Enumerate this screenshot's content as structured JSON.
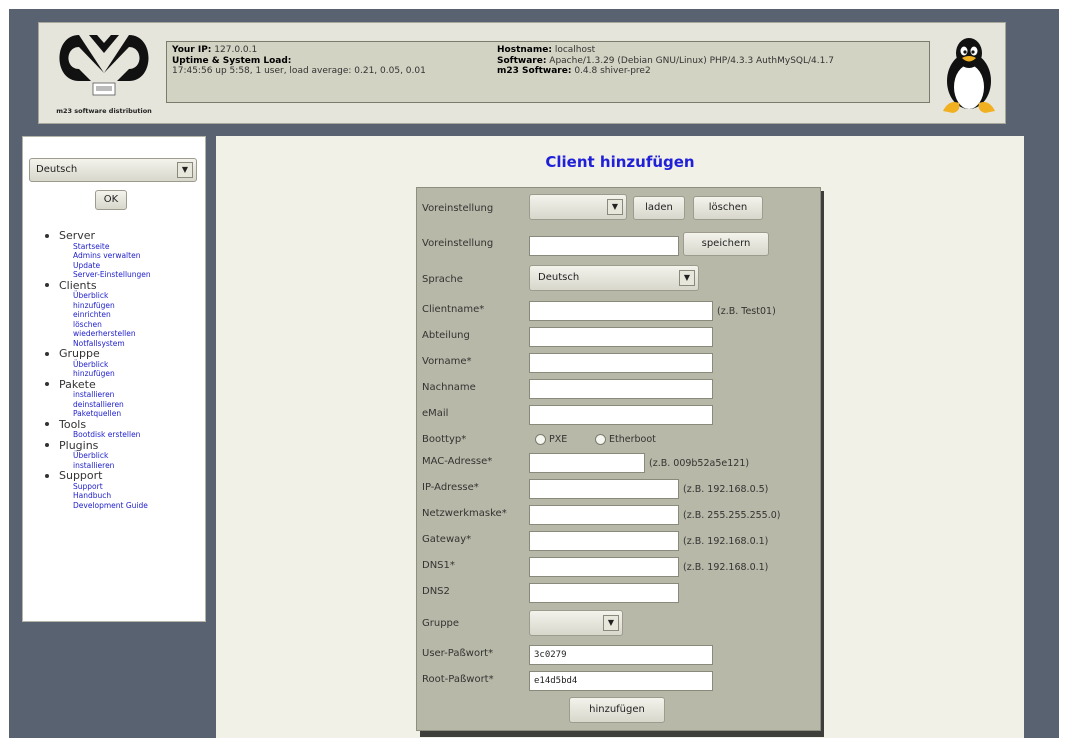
{
  "header": {
    "logo_caption": "m23 software distribution",
    "your_ip_label": "Your IP:",
    "your_ip_value": "127.0.0.1",
    "uptime_label": "Uptime & System Load:",
    "uptime_value": "17:45:56 up 5:58, 1 user, load average: 0.21, 0.05, 0.01",
    "hostname_label": "Hostname:",
    "hostname_value": "localhost",
    "software_label": "Software:",
    "software_value": "Apache/1.3.29 (Debian GNU/Linux) PHP/4.3.3 AuthMySQL/4.1.7",
    "m23_label": "m23 Software:",
    "m23_value": "0.4.8 shiver-pre2"
  },
  "sidebar": {
    "language": "Deutsch",
    "ok_label": "OK",
    "groups": [
      {
        "title": "Server",
        "items": [
          "Startseite",
          "Admins verwalten",
          "Update",
          "Server-Einstellungen"
        ]
      },
      {
        "title": "Clients",
        "items": [
          "Überblick",
          "hinzufügen",
          "einrichten",
          "löschen",
          "wiederherstellen",
          "Notfallsystem"
        ]
      },
      {
        "title": "Gruppe",
        "items": [
          "Überblick",
          "hinzufügen"
        ]
      },
      {
        "title": "Pakete",
        "items": [
          "installieren",
          "deinstallieren",
          "Paketquellen"
        ]
      },
      {
        "title": "Tools",
        "items": [
          "Bootdisk erstellen"
        ]
      },
      {
        "title": "Plugins",
        "items": [
          "Überblick",
          "installieren"
        ]
      },
      {
        "title": "Support",
        "items": [
          "Support",
          "Handbuch",
          "Development Guide"
        ]
      }
    ]
  },
  "main": {
    "title": "Client hinzufügen",
    "form": {
      "preset_label": "Voreinstellung",
      "preset_value": "",
      "load_label": "laden",
      "delete_label": "löschen",
      "preset_name_label": "Voreinstellung",
      "preset_name_value": "",
      "save_label": "speichern",
      "language_label": "Sprache",
      "language_value": "Deutsch",
      "clientname_label": "Clientname*",
      "clientname_hint": "(z.B. Test01)",
      "department_label": "Abteilung",
      "firstname_label": "Vorname*",
      "lastname_label": "Nachname",
      "email_label": "eMail",
      "boottype_label": "Boottyp*",
      "boot_pxe": "PXE",
      "boot_etherboot": "Etherboot",
      "mac_label": "MAC-Adresse*",
      "mac_hint": "(z.B. 009b52a5e121)",
      "ip_label": "IP-Adresse*",
      "ip_hint": "(z.B. 192.168.0.5)",
      "netmask_label": "Netzwerkmaske*",
      "netmask_hint": "(z.B. 255.255.255.0)",
      "gateway_label": "Gateway*",
      "gateway_hint": "(z.B. 192.168.0.1)",
      "dns1_label": "DNS1*",
      "dns1_hint": "(z.B. 192.168.0.1)",
      "dns2_label": "DNS2",
      "group_label": "Gruppe",
      "group_value": "",
      "user_pw_label": "User-Paßwort*",
      "user_pw_value": "3c0279",
      "root_pw_label": "Root-Paßwort*",
      "root_pw_value": "e14d5bd4",
      "submit_label": "hinzufügen"
    }
  }
}
